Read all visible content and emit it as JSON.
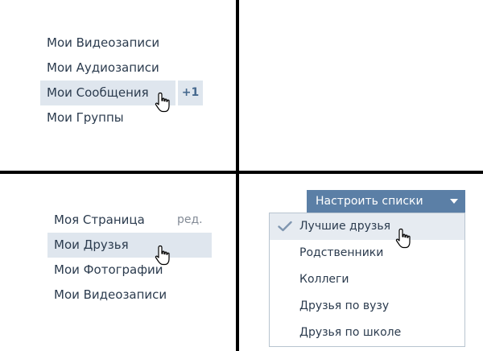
{
  "panel1": {
    "items": [
      {
        "label": "Мои Видеозаписи"
      },
      {
        "label": "Мои Аудиозаписи"
      },
      {
        "label": "Мои Сообщения",
        "badge": "+1"
      },
      {
        "label": "Мои Группы"
      }
    ]
  },
  "panel3": {
    "items": [
      {
        "label": "Моя Страница",
        "edit": "ред."
      },
      {
        "label": "Мои Друзья"
      },
      {
        "label": "Мои Фотографии"
      },
      {
        "label": "Мои Видеозаписи"
      }
    ]
  },
  "panel4": {
    "button_label": "Настроить списки",
    "items": [
      {
        "label": "Лучшие друзья",
        "checked": true
      },
      {
        "label": "Родственники"
      },
      {
        "label": "Коллеги"
      },
      {
        "label": "Друзья по вузу"
      },
      {
        "label": "Друзья по школе"
      }
    ]
  },
  "colors": {
    "highlight": "#dfe6ee",
    "button_bg": "#5b7fa6",
    "text": "#2b3b4e",
    "badge_text": "#45688e",
    "check": "#7f96b0"
  },
  "icons": [
    "hand-pointer-icon",
    "checkmark-icon",
    "caret-down-icon"
  ]
}
